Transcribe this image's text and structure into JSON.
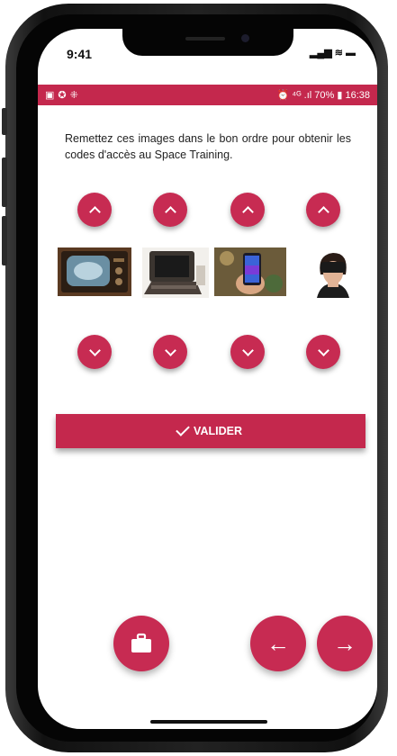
{
  "ios_status": {
    "time": "9:41",
    "icons": "▂▄▆ ≋ ▬"
  },
  "android_status": {
    "left_icons": "▣✪⁜",
    "right": "⏰ ⁴ᴳ .ıl 70% ▮ 16:38"
  },
  "instruction": "Remettez ces images dans le bon ordre pour obtenir les codes d'accès au Space Training.",
  "images": [
    {
      "name": "vintage-television"
    },
    {
      "name": "old-computer-terminal"
    },
    {
      "name": "smartphone-in-hand"
    },
    {
      "name": "woman-vr-headset"
    }
  ],
  "validate_button": {
    "label": "VALIDER"
  },
  "bottom_nav": {
    "briefcase_icon": "briefcase-icon",
    "back_glyph": "←",
    "next_glyph": "→"
  },
  "colors": {
    "accent": "#c72b52",
    "status_bar": "#c4284d"
  }
}
